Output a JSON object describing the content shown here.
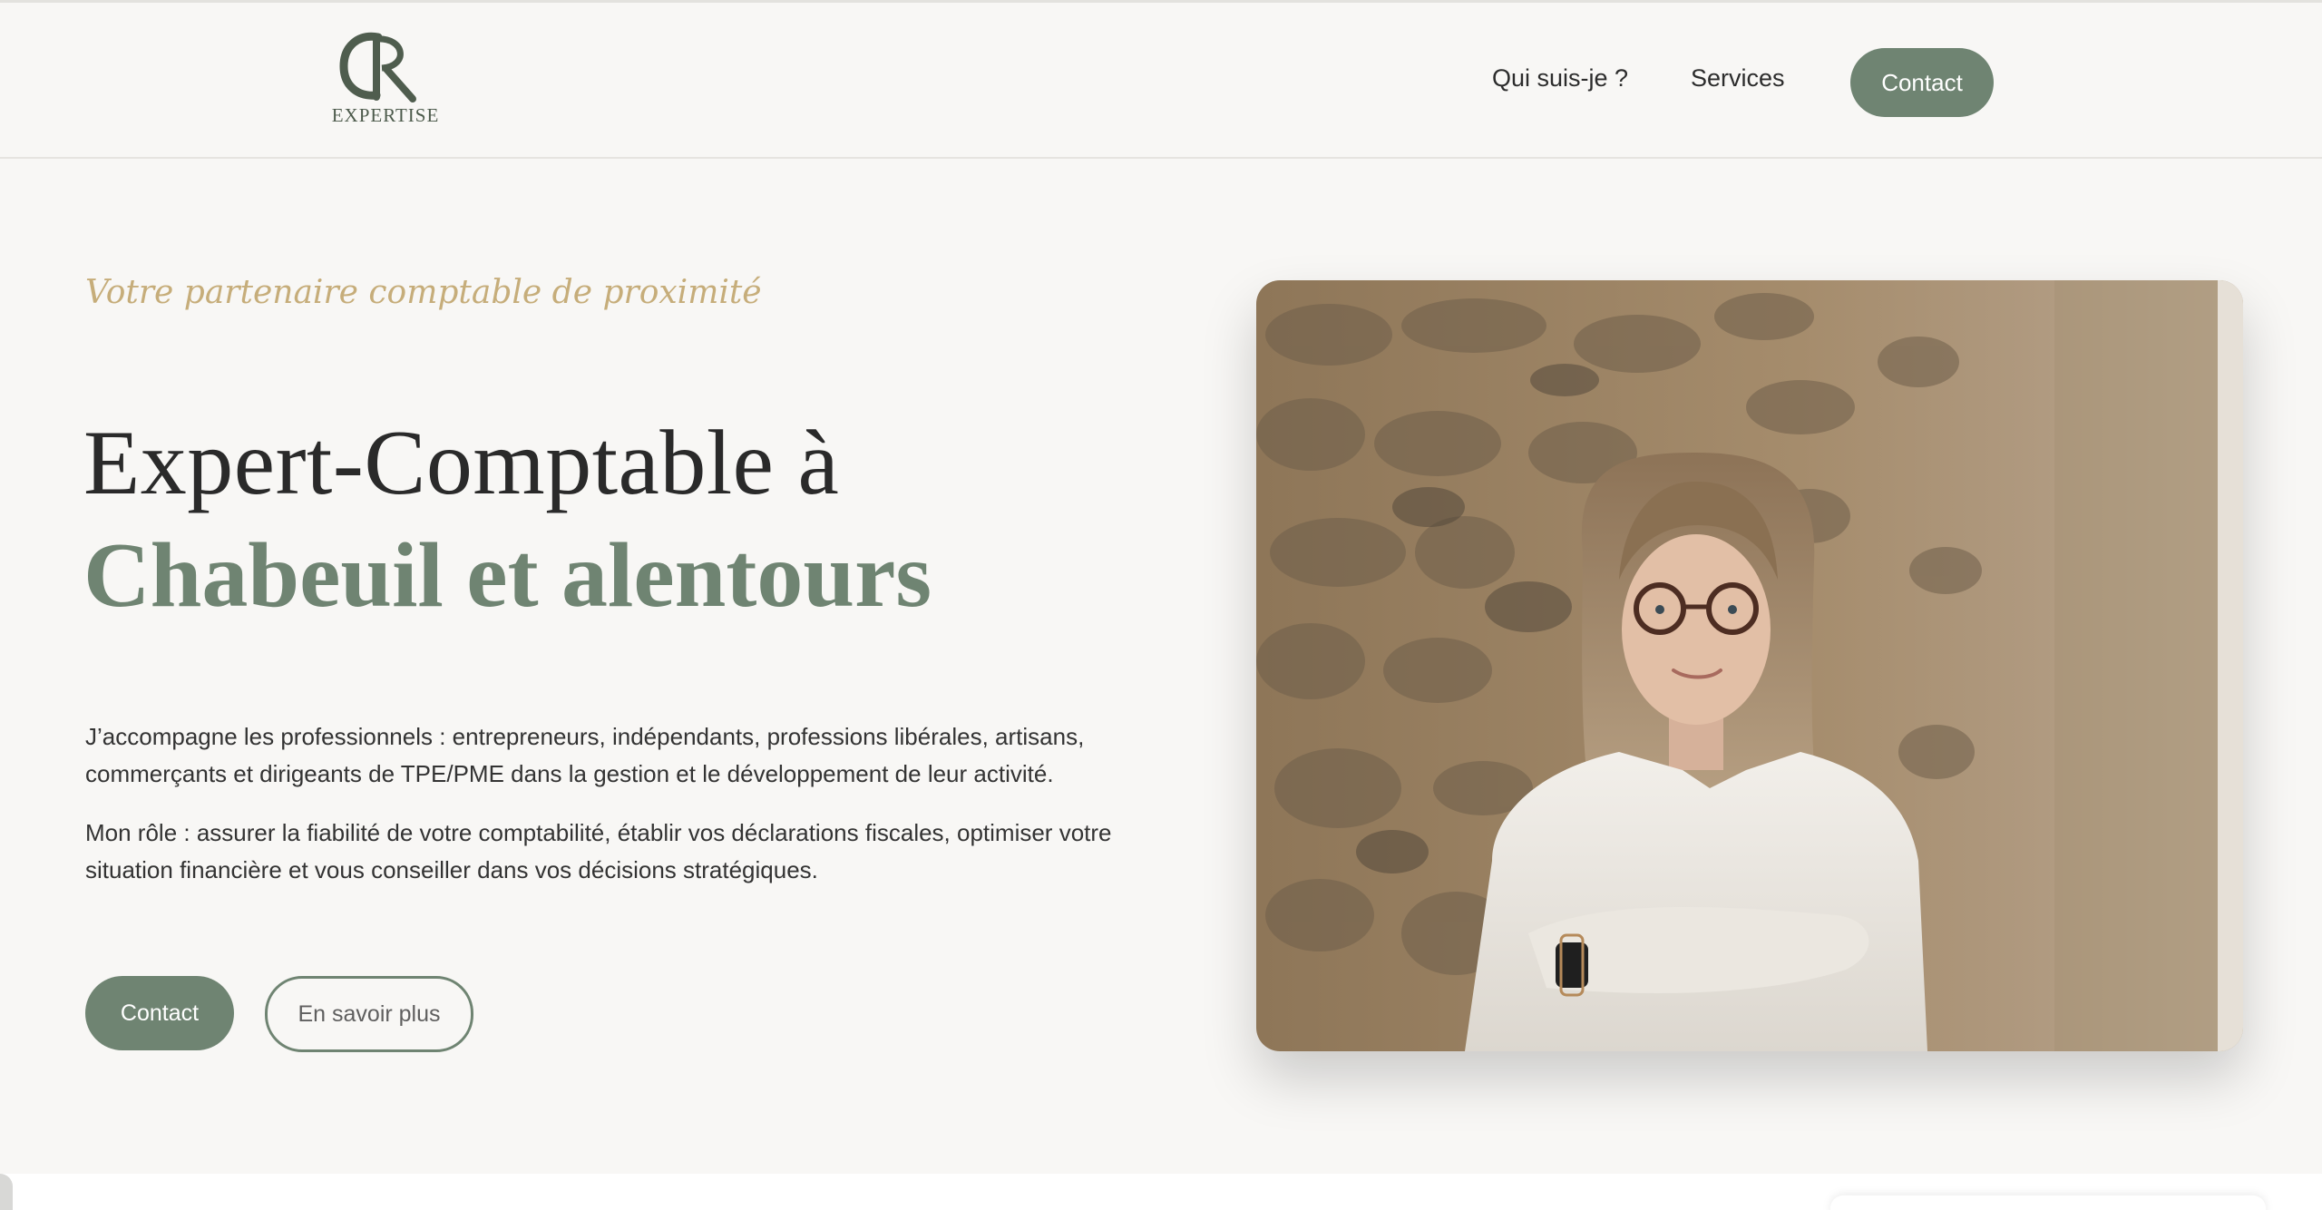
{
  "header": {
    "logo": {
      "monogram": "CR",
      "text": "EXPERTISE"
    },
    "nav": [
      {
        "label": "Qui suis-je ?"
      },
      {
        "label": "Services"
      }
    ],
    "contact_label": "Contact"
  },
  "hero": {
    "tagline": "Votre partenaire comptable de proximité",
    "title_line1": "Expert-Comptable à",
    "title_line2": "Chabeuil et alentours",
    "paragraph1": "J’accompagne les professionnels : entrepreneurs, indépendants, professions libérales, artisans, commerçants et dirigeants de TPE/PME dans la gestion et le développement de leur activité.",
    "paragraph2": "Mon rôle : assurer la fiabilité de votre comptabilité, établir vos déclarations fiscales, optimiser votre situation financière et vous conseiller dans vos décisions stratégiques.",
    "primary_button": "Contact",
    "secondary_button": "En savoir plus"
  },
  "colors": {
    "accent_green": "#6f8472",
    "tagline_gold": "#c6ad7a",
    "background": "#f8f7f5"
  }
}
